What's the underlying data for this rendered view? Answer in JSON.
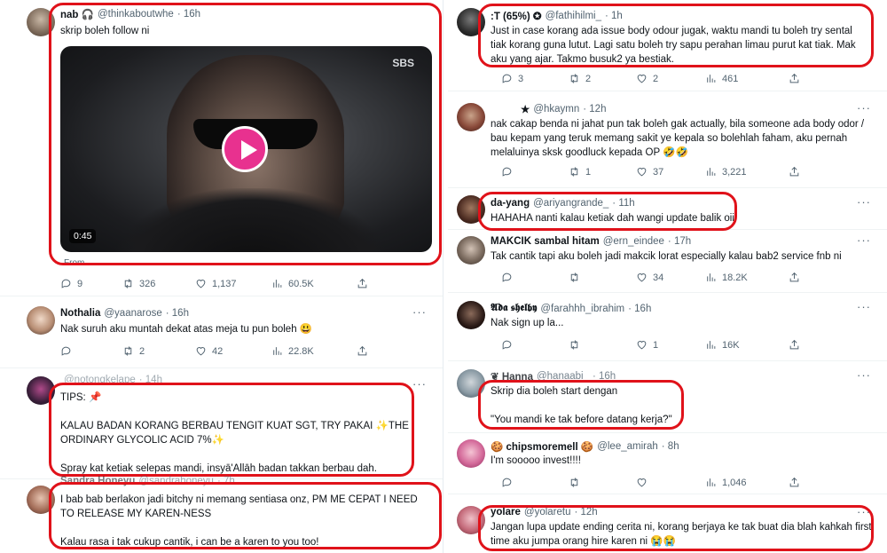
{
  "left": [
    {
      "name": "nab 🎧",
      "handle": "@thinkaboutwhe",
      "time": "· 16h",
      "text": "skrip boleh follow ni",
      "video_badge": "SBS",
      "video_duration": "0:45",
      "from_label": "From",
      "stats": {
        "replies": "9",
        "retweets": "326",
        "likes": "1,137",
        "views": "60.5K"
      }
    },
    {
      "name": "Nothalia",
      "handle": "@yaanarose",
      "time": "· 16h",
      "text": "Nak suruh aku muntah dekat atas meja tu pun boleh 😃",
      "stats": {
        "replies": "",
        "retweets": "2",
        "likes": "42",
        "views": "22.8K"
      }
    },
    {
      "name": "",
      "handle": "@notongkelape",
      "time": "· 14h",
      "text": "TIPS: 📌\n\nKALAU BADAN KORANG BERBAU TENGIT KUAT SGT, TRY PAKAI ✨THE ORDINARY GLYCOLIC ACID 7%✨\n\nSpray kat ketiak selepas mandi, insyā'Allāh badan takkan berbau dah."
    },
    {
      "name": "Sandra Honeyu",
      "handle": "@sandrahoneyu",
      "time": "· 7h",
      "text": "I bab bab berlakon jadi bitchy ni memang sentiasa onz, PM ME CEPAT I NEED TO RELEASE MY KAREN-NESS\n\nKalau rasa i tak cukup cantik, i can be a karen to you too!"
    }
  ],
  "right": [
    {
      "name": ":T (65%) ✪",
      "handle": "@fathihilmi_",
      "time": "· 1h",
      "text": "Just in case korang ada issue body odour jugak, waktu mandi tu boleh try sental tiak korang guna lutut. Lagi satu boleh try sapu perahan limau purut kat tiak. Mak aku yang ajar. Takmo busuk2 ya bestiak.",
      "stats": {
        "replies": "3",
        "retweets": "2",
        "likes": "2",
        "views": "461"
      }
    },
    {
      "name": "★",
      "handle": "@hkaymn",
      "time": "· 12h",
      "text": "nak cakap benda ni jahat pun tak boleh gak actually, bila someone ada body odor / bau kepam yang teruk memang sakit ye kepala so bolehlah faham, aku pernah melaluinya sksk goodluck kepada OP 🤣🤣",
      "stats": {
        "replies": "",
        "retweets": "1",
        "likes": "37",
        "views": "3,221"
      }
    },
    {
      "name": "da-yang",
      "handle": "@ariyangrande_",
      "time": "· 11h",
      "text": "HAHAHA nanti kalau ketiak dah wangi update balik oiii"
    },
    {
      "name": "MAKCIK sambal hitam",
      "handle": "@ern_eindee",
      "time": "· 17h",
      "text": "Tak cantik tapi aku boleh jadi makcik lorat especially kalau bab2 service fnb ni",
      "stats": {
        "replies": "",
        "retweets": "",
        "likes": "34",
        "views": "18.2K"
      }
    },
    {
      "name": "𝕬𝖉𝖆 𝖘𝖍𝖊𝖑𝖇𝖞",
      "handle": "@farahhh_ibrahim",
      "time": "· 16h",
      "text": "Nak sign up la...",
      "stats": {
        "replies": "",
        "retweets": "",
        "likes": "1",
        "views": "16K"
      }
    },
    {
      "name": "❦ Hanna",
      "handle": "@hanaabi_",
      "time": "· 16h",
      "text": "Skrip dia boleh start dengan\n\n\"You mandi ke tak before datang kerja?\""
    },
    {
      "name": "🍪 chipsmoremell 🍪",
      "handle": "@lee_amirah",
      "time": "· 8h",
      "text": "I'm sooooo invest!!!!",
      "stats": {
        "replies": "",
        "retweets": "",
        "likes": "",
        "views": "1,046"
      }
    },
    {
      "name": "yolare",
      "handle": "@yolaretu",
      "time": "· 12h",
      "text": "Jangan lupa update ending cerita ni, korang berjaya ke tak buat dia blah kahkah first time aku jumpa orang hire karen ni 😭😭"
    }
  ],
  "more_label": "···",
  "colors": {
    "highlight": "#e0121a",
    "text": "#0f1419",
    "muted": "#536471",
    "play": "#e8318f"
  }
}
